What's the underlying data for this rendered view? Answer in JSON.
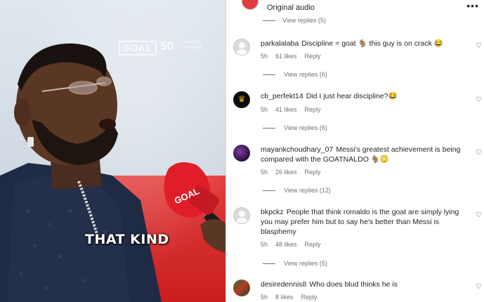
{
  "video": {
    "brand_badge": "GOAL",
    "brand_fifty": "50",
    "brand_small": "the most influential",
    "mic_label": "GOAL",
    "caption": "THAT KIND"
  },
  "header": {
    "title": "Original audio",
    "more": "•••",
    "top_replies": "View replies (5)"
  },
  "comments": [
    {
      "username": "parkalalaba",
      "text": "Discipline = goat 🐐 this guy is on crack 😂",
      "time": "5h",
      "likes": "61 likes",
      "reply": "Reply",
      "view_replies": "View replies (6)",
      "avatar": "default-avatar"
    },
    {
      "username": "cb_perfekt14",
      "text": "Did I just hear discipline?😂",
      "time": "5h",
      "likes": "41 likes",
      "reply": "Reply",
      "view_replies": "View replies (6)",
      "avatar": "crown-avatar"
    },
    {
      "username": "mayankchoudhary_07",
      "text": "Messi's greatest achievement is being compared with the GOATNALDO 🐐😳",
      "time": "5h",
      "likes": "26 likes",
      "reply": "Reply",
      "view_replies": "View replies (12)",
      "avatar": "photo-avatar"
    },
    {
      "username": "bkpckz",
      "text": "People that think romaldo is the goat are simply lying you may prefer him but to say he's better than Messi is blasphemy",
      "time": "5h",
      "likes": "48 likes",
      "reply": "Reply",
      "view_replies": "View replies (5)",
      "avatar": "default-avatar"
    },
    {
      "username": "desiredennis8",
      "text": "Who does blud thinks he is",
      "time": "5h",
      "likes": "8 likes",
      "reply": "Reply",
      "avatar": "photo-avatar"
    }
  ],
  "colors": {
    "backdrop_red": "#d32a2a",
    "muted_text": "#737373",
    "text": "#262626",
    "divider": "#dbdbdb"
  }
}
